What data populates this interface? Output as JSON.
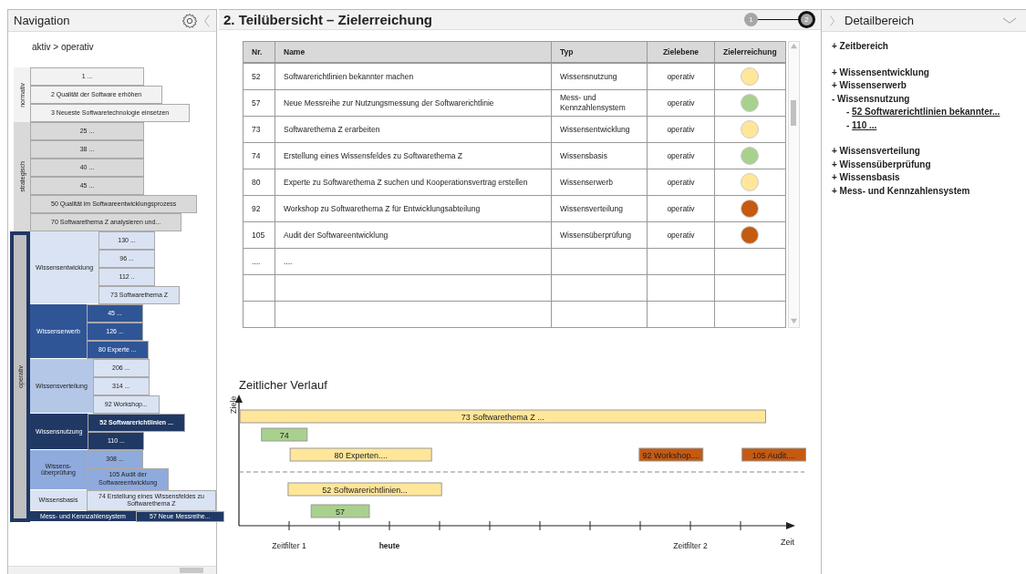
{
  "navigation": {
    "title": "Navigation",
    "breadcrumb": "aktiv > operativ",
    "levels": [
      {
        "label": "normativ",
        "color": "#f2f2f2",
        "selected": false,
        "items": [
          {
            "text": "1 ...",
            "selected": false
          },
          {
            "text": "2 Qualität der Software erhöhen",
            "selected": false
          },
          {
            "text": "3 Neueste Softwaretechnologie einsetzen",
            "selected": false
          }
        ]
      },
      {
        "label": "strategisch",
        "color": "#d9d9d9",
        "selected": false,
        "items": [
          {
            "text": "25 ...",
            "selected": false
          },
          {
            "text": "38 ...",
            "selected": false
          },
          {
            "text": "40 ...",
            "selected": false
          },
          {
            "text": "45 ...",
            "selected": false
          },
          {
            "text": "50 Qualität im Softwareentwicklungsprozess",
            "selected": false
          },
          {
            "text": "70 Softwarethema Z analysieren und...",
            "selected": false
          }
        ]
      },
      {
        "label": "operativ",
        "color": "#bfbfbf",
        "selected": true,
        "groups": [
          {
            "label": "Wissensentwicklung",
            "color": "#dae3f3",
            "items": [
              {
                "text": "130 ...",
                "selected": false,
                "color": "#dae3f3"
              },
              {
                "text": "96 ...",
                "selected": false,
                "color": "#dae3f3"
              },
              {
                "text": "112 ..",
                "selected": false,
                "color": "#dae3f3"
              },
              {
                "text": "73 Softwarethema Z",
                "selected": false,
                "color": "#dae3f3"
              }
            ]
          },
          {
            "label": "Wissenserwerb",
            "color": "#2f5597",
            "items": [
              {
                "text": "45 ...",
                "selected": false,
                "color": "#2f5597"
              },
              {
                "text": "126 ...",
                "selected": false,
                "color": "#2f5597"
              },
              {
                "text": "80 Experte ...",
                "selected": false,
                "color": "#2f5597"
              }
            ]
          },
          {
            "label": "Wissensverteilung",
            "color": "#b4c7e7",
            "items": [
              {
                "text": "206 ...",
                "selected": false,
                "color": "#dae3f3"
              },
              {
                "text": "314 ...",
                "selected": false,
                "color": "#dae3f3"
              },
              {
                "text": "92 Workshop...",
                "selected": false,
                "color": "#dae3f3"
              }
            ]
          },
          {
            "label": "Wissensnutzung",
            "color": "#203864",
            "items": [
              {
                "text": "52 Softwarerichtlinien ...",
                "selected": true,
                "color": "#203864"
              },
              {
                "text": "110 ...",
                "selected": false,
                "color": "#203864"
              }
            ]
          },
          {
            "label": "Wissens-\nüberprüfung",
            "color": "#8faadc",
            "items": [
              {
                "text": "308 ...",
                "selected": false,
                "color": "#8faadc"
              },
              {
                "text": "105 Audit der\nSoftwareentwicklung",
                "selected": false,
                "color": "#8faadc"
              }
            ]
          },
          {
            "label": "Wissensbasis",
            "color": "#dae3f3",
            "items": [
              {
                "text": "74 Erstellung eines Wissensfeldes zu\nSoftwarethema Z",
                "selected": false,
                "color": "#dae3f3"
              }
            ]
          },
          {
            "label": "Mess- und Kennzahlensystem",
            "color": "#203864",
            "items": [
              {
                "text": "57 Neue Messreihe...",
                "selected": false,
                "color": "#203864"
              }
            ]
          }
        ]
      }
    ]
  },
  "overview": {
    "title": "2. Teilübersicht – Zielerreichung",
    "steps": [
      {
        "label": "1",
        "selected": false
      },
      {
        "label": "2",
        "selected": true
      }
    ],
    "table": {
      "columns": [
        "Nr.",
        "Name",
        "Typ",
        "Zielebene",
        "Zielerreichung"
      ],
      "rows": [
        {
          "nr": "52",
          "name": "Softwarerichtlinien bekannter machen",
          "type": "Wissensnutzung",
          "level": "operativ",
          "color": "#ffe699"
        },
        {
          "nr": "57",
          "name": "Neue Messreihe zur Nutzungsmessung der Softwarerichtlinie",
          "type": "Mess- und\nKennzahlensystem",
          "level": "operativ",
          "color": "#a9d18e"
        },
        {
          "nr": "73",
          "name": "Softwarethema Z erarbeiten",
          "type": "Wissensentwicklung",
          "level": "operativ",
          "color": "#ffe699"
        },
        {
          "nr": "74",
          "name": "Erstellung eines Wissensfeldes zu Softwarethema Z",
          "type": "Wissensbasis",
          "level": "operativ",
          "color": "#a9d18e"
        },
        {
          "nr": "80",
          "name": "Experte zu Softwarethema Z suchen und Kooperationsvertrag erstellen",
          "type": "Wissenserwerb",
          "level": "operativ",
          "color": "#ffe699"
        },
        {
          "nr": "92",
          "name": "Workshop zu Softwarethema Z für Entwicklungsabteilung",
          "type": "Wissensverteilung",
          "level": "operativ",
          "color": "#c55a11"
        },
        {
          "nr": "105",
          "name": "Audit der Softwareentwicklung",
          "type": "Wissensüberprüfung",
          "level": "operativ",
          "color": "#c55a11"
        },
        {
          "nr": "....",
          "name": "...."
        }
      ]
    },
    "timeline": {
      "title": "Zeitlicher Verlauf",
      "y_label": "Ziele",
      "x_label": "Zeit",
      "sections": [
        {
          "rows": [
            [
              {
                "label": "73 Softwarethema Z ...",
                "color": "#ffe699"
              }
            ],
            [
              {
                "label": "74",
                "color": "#a9d18e"
              }
            ],
            [
              {
                "label": "80 Experten....",
                "color": "#ffe699"
              },
              {
                "label": "92 Workshop....",
                "color": "#c55a11"
              },
              {
                "label": "105 Audit....",
                "color": "#c55a11"
              }
            ]
          ]
        },
        {
          "rows": [
            [
              {
                "label": "52 Softwarerichtlinien...",
                "color": "#ffe699"
              }
            ],
            [
              {
                "label": "57",
                "color": "#a9d18e"
              }
            ]
          ]
        }
      ],
      "markers": [
        {
          "label": "Zeitfilter 1",
          "bold": false
        },
        {
          "label": "heute",
          "bold": true
        },
        {
          "label": "Zeitfilter 2",
          "bold": false
        }
      ]
    }
  },
  "detail": {
    "title": "Detailbereich",
    "groups": [
      [
        {
          "sign": "+",
          "label": "Zeitbereich"
        }
      ],
      [
        {
          "sign": "+",
          "label": "Wissensentwicklung"
        },
        {
          "sign": "+",
          "label": "Wissenserwerb"
        },
        {
          "sign": "-",
          "label": "Wissensnutzung",
          "children": [
            {
              "sign": "-",
              "label": "52 Softwarerichtlinien bekannter..."
            },
            {
              "sign": "-",
              "label": "110 ..."
            }
          ]
        }
      ],
      [
        {
          "sign": "+",
          "label": "Wissensverteilung"
        },
        {
          "sign": "+",
          "label": "Wissensüberprüfung"
        },
        {
          "sign": "+",
          "label": "Wissensbasis"
        },
        {
          "sign": "+",
          "label": "Mess- und Kennzahlensystem"
        }
      ]
    ]
  }
}
